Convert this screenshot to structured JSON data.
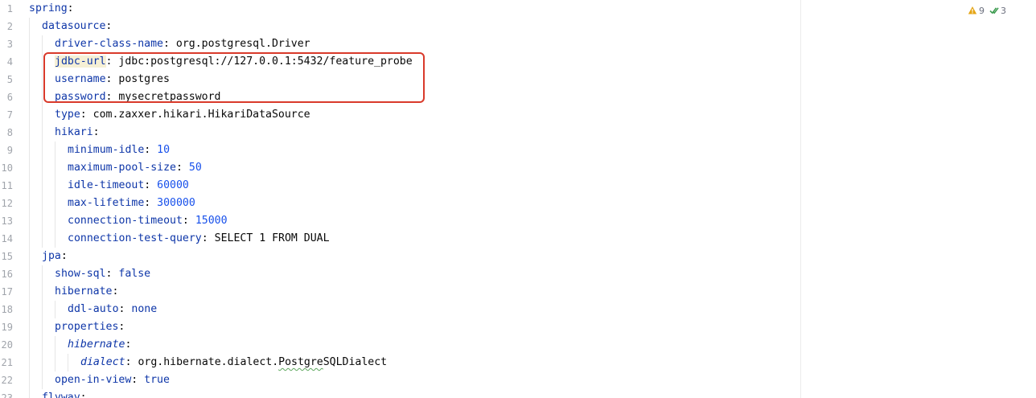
{
  "inspection": {
    "warnings": "9",
    "weak_warnings": "3"
  },
  "lines": [
    {
      "n": "1",
      "indent": 0,
      "key": "spring",
      "sep": ":",
      "value": "",
      "vtype": ""
    },
    {
      "n": "2",
      "indent": 1,
      "key": "datasource",
      "sep": ":",
      "value": "",
      "vtype": ""
    },
    {
      "n": "3",
      "indent": 2,
      "key": "driver-class-name",
      "sep": ": ",
      "value": "org.postgresql.Driver",
      "vtype": "str"
    },
    {
      "n": "4",
      "indent": 2,
      "key": "jdbc-url",
      "sep": ": ",
      "value": "jdbc:postgresql://127.0.0.1:5432/feature_probe",
      "vtype": "str"
    },
    {
      "n": "5",
      "indent": 2,
      "key": "username",
      "sep": ": ",
      "value": "postgres",
      "vtype": "str"
    },
    {
      "n": "6",
      "indent": 2,
      "key": "password",
      "sep": ": ",
      "value": "mysecretpassword",
      "vtype": "str"
    },
    {
      "n": "7",
      "indent": 2,
      "key": "type",
      "sep": ": ",
      "value": "com.zaxxer.hikari.HikariDataSource",
      "vtype": "str"
    },
    {
      "n": "8",
      "indent": 2,
      "key": "hikari",
      "sep": ":",
      "value": "",
      "vtype": ""
    },
    {
      "n": "9",
      "indent": 3,
      "key": "minimum-idle",
      "sep": ": ",
      "value": "10",
      "vtype": "num"
    },
    {
      "n": "10",
      "indent": 3,
      "key": "maximum-pool-size",
      "sep": ": ",
      "value": "50",
      "vtype": "num"
    },
    {
      "n": "11",
      "indent": 3,
      "key": "idle-timeout",
      "sep": ": ",
      "value": "60000",
      "vtype": "num"
    },
    {
      "n": "12",
      "indent": 3,
      "key": "max-lifetime",
      "sep": ": ",
      "value": "300000",
      "vtype": "num"
    },
    {
      "n": "13",
      "indent": 3,
      "key": "connection-timeout",
      "sep": ": ",
      "value": "15000",
      "vtype": "num"
    },
    {
      "n": "14",
      "indent": 3,
      "key": "connection-test-query",
      "sep": ": ",
      "value": "SELECT 1 FROM DUAL",
      "vtype": "str"
    },
    {
      "n": "15",
      "indent": 1,
      "key": "jpa",
      "sep": ":",
      "value": "",
      "vtype": ""
    },
    {
      "n": "16",
      "indent": 2,
      "key": "show-sql",
      "sep": ": ",
      "value": "false",
      "vtype": "kw"
    },
    {
      "n": "17",
      "indent": 2,
      "key": "hibernate",
      "sep": ":",
      "value": "",
      "vtype": ""
    },
    {
      "n": "18",
      "indent": 3,
      "key": "ddl-auto",
      "sep": ": ",
      "value": "none",
      "vtype": "kw"
    },
    {
      "n": "19",
      "indent": 2,
      "key": "properties",
      "sep": ":",
      "value": "",
      "vtype": ""
    },
    {
      "n": "20",
      "indent": 3,
      "key": "hibernate",
      "sep": ":",
      "value": "",
      "vtype": "",
      "italic": true
    },
    {
      "n": "21",
      "indent": 4,
      "key": "dialect",
      "sep": ": ",
      "value": "org.hibernate.dialect.PostgreSQLDialect",
      "vtype": "str",
      "italic": true
    },
    {
      "n": "22",
      "indent": 2,
      "key": "open-in-view",
      "sep": ": ",
      "value": "true",
      "vtype": "kw"
    },
    {
      "n": "23",
      "indent": 1,
      "key": "flyway",
      "sep": ":",
      "value": "",
      "vtype": ""
    }
  ]
}
